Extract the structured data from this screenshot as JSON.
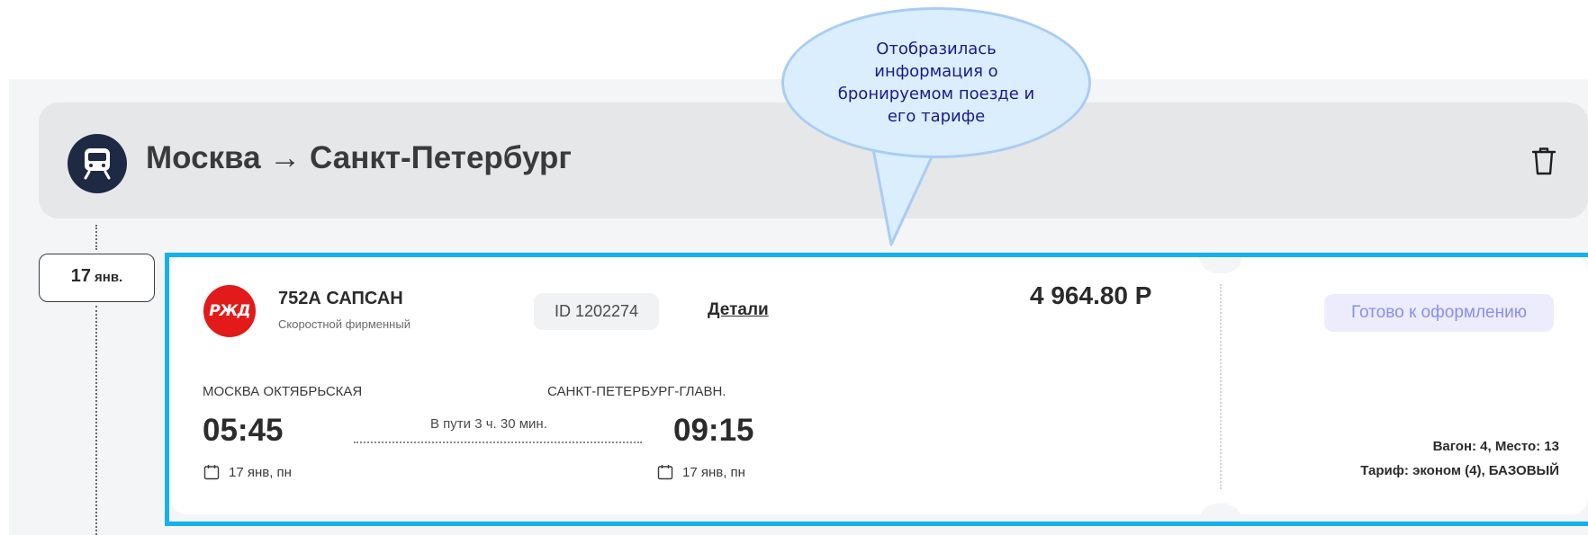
{
  "header": {
    "route_title": "Москва → Санкт-Петербург",
    "trip_icon": "train-icon",
    "delete_icon": "trash-icon"
  },
  "timeline": {
    "date_day": "17",
    "date_month": "янв."
  },
  "booking": {
    "carrier_logo_text": "РЖД",
    "train_number": "752А САПСАН",
    "train_type": "Скоростной фирменный",
    "id_label": "ID 1202274",
    "details_label": "Детали",
    "price": "4 964.80 Р",
    "status": "Готово к оформлению",
    "departure": {
      "station": "МОСКВА ОКТЯБРЬСКАЯ",
      "time": "05:45",
      "date": "17 янв, пн"
    },
    "arrival": {
      "station": "САНКТ-ПЕТЕРБУРГ-ГЛАВН.",
      "time": "09:15",
      "date": "17 янв, пн"
    },
    "duration": "В пути 3 ч. 30 мин.",
    "seat": "Вагон: 4, Место: 13",
    "tariff": "Тариф: эконом (4), БАЗОВЫЙ"
  },
  "callout": {
    "text": "Отобразилась информация о бронируемом поезде и его тарифе"
  },
  "colors": {
    "highlight": "#13b1ef",
    "rzd_red": "#e21a1a",
    "status_text": "#8a8ef0",
    "status_bg": "#ececfd",
    "header_bg": "#e6e7e9",
    "train_badge": "#1e2a44",
    "callout_bg": "#dbeefd"
  }
}
